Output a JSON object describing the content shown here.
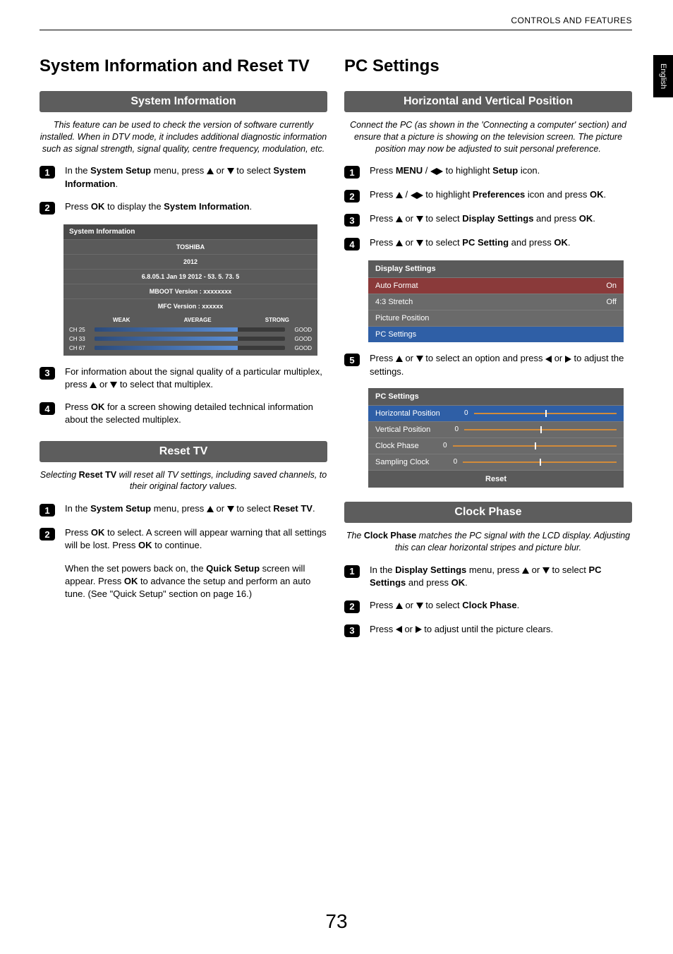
{
  "header": "CONTROLS AND FEATURES",
  "sideTab": "English",
  "pageNumber": "73",
  "left": {
    "h1": "System Information and Reset TV",
    "sec1": {
      "heading": "System Information",
      "intro": "This feature can be used to check the version of software currently installed. When in DTV mode, it includes additional diagnostic information such as signal strength, signal quality, centre frequency, modulation, etc.",
      "steps": {
        "s1a": "In the ",
        "s1b": "System Setup",
        "s1c": " menu, press ",
        "s1d": " or ",
        "s1e": " to select ",
        "s1f": "System Information",
        "s1g": ".",
        "s2a": "Press ",
        "s2b": "OK",
        "s2c": " to display the ",
        "s2d": "System Information",
        "s2e": ".",
        "s3a": "For information about the signal quality of a particular multiplex, press ",
        "s3b": " or ",
        "s3c": " to select that multiplex.",
        "s4a": "Press ",
        "s4b": "OK",
        "s4c": " for a screen showing detailed technical information about the selected multiplex."
      },
      "panel": {
        "title": "System Information",
        "brand": "TOSHIBA",
        "year": "2012",
        "ver": "6.8.05.1 Jan 19 2012 - 53. 5. 73. 5",
        "mboot": "MBOOT Version : xxxxxxxx",
        "mfc": "MFC Version : xxxxxx",
        "labels": {
          "weak": "WEAK",
          "avg": "AVERAGE",
          "strong": "STRONG"
        },
        "rows": [
          {
            "ch": "CH 25",
            "status": "GOOD"
          },
          {
            "ch": "CH 33",
            "status": "GOOD"
          },
          {
            "ch": "CH 67",
            "status": "GOOD"
          }
        ]
      }
    },
    "sec2": {
      "heading": "Reset TV",
      "intro_a": "Selecting ",
      "intro_b": "Reset TV",
      "intro_c": " will reset all TV settings, including saved channels, to their original factory values.",
      "steps": {
        "s1a": "In the ",
        "s1b": "System Setup",
        "s1c": " menu, press ",
        "s1d": " or ",
        "s1e": " to select ",
        "s1f": "Reset TV",
        "s1g": ".",
        "s2a": "Press ",
        "s2b": "OK",
        "s2c": " to select. A screen will appear warning that all settings will be lost. Press ",
        "s2d": "OK",
        "s2e": " to continue.",
        "s2f": "When the set powers back on, the ",
        "s2g": "Quick Setup",
        "s2h": " screen will appear. Press ",
        "s2i": "OK",
        "s2j": " to advance the setup and perform an auto tune. (See \"Quick Setup\" section on page 16.)"
      }
    }
  },
  "right": {
    "h1": "PC Settings",
    "sec1": {
      "heading": "Horizontal and Vertical Position",
      "intro": "Connect the PC (as shown in the 'Connecting a computer' section) and ensure that a picture is showing on the television screen. The picture position may now be adjusted to suit personal preference.",
      "steps": {
        "s1a": "Press ",
        "s1b": "MENU",
        "s1c": " / ",
        "s1d": " to highlight ",
        "s1e": "Setup",
        "s1f": " icon.",
        "s2a": "Press ",
        "s2b": " / ",
        "s2c": " to highlight ",
        "s2d": "Preferences",
        "s2e": " icon and press ",
        "s2f": "OK",
        "s2g": ".",
        "s3a": "Press ",
        "s3b": " or ",
        "s3c": " to select ",
        "s3d": "Display Settings",
        "s3e": " and press ",
        "s3f": "OK",
        "s3g": ".",
        "s4a": "Press ",
        "s4b": " or ",
        "s4c": " to select ",
        "s4d": "PC Setting",
        "s4e": " and press ",
        "s4f": "OK",
        "s4g": ".",
        "s5a": "Press ",
        "s5b": " or ",
        "s5c": " to select an option and press ",
        "s5d": " or ",
        "s5e": " to adjust the settings."
      },
      "panel1": {
        "title": "Display Settings",
        "rows": [
          {
            "label": "Auto Format",
            "val": "On"
          },
          {
            "label": "4:3 Stretch",
            "val": "Off"
          },
          {
            "label": "Picture Position",
            "val": ""
          },
          {
            "label": "PC Settings",
            "val": ""
          }
        ]
      },
      "panel2": {
        "title": "PC Settings",
        "rows": [
          {
            "label": "Horizontal Position",
            "val": "0"
          },
          {
            "label": "Vertical Position",
            "val": "0"
          },
          {
            "label": "Clock Phase",
            "val": "0"
          },
          {
            "label": "Sampling Clock",
            "val": "0"
          }
        ],
        "reset": "Reset"
      }
    },
    "sec2": {
      "heading": "Clock Phase",
      "intro_a": "The ",
      "intro_b": "Clock Phase",
      "intro_c": " matches the PC signal with the LCD display. Adjusting this can clear horizontal stripes and picture blur.",
      "steps": {
        "s1a": "In the ",
        "s1b": "Display Settings",
        "s1c": " menu, press ",
        "s1d": " or ",
        "s1e": " to select ",
        "s1f": "PC Settings",
        "s1g": " and press ",
        "s1h": "OK",
        "s1i": ".",
        "s2a": "Press ",
        "s2b": " or ",
        "s2c": " to select ",
        "s2d": "Clock Phase",
        "s2e": ".",
        "s3a": "Press ",
        "s3b": " or ",
        "s3c": " to adjust until the picture clears."
      }
    }
  }
}
